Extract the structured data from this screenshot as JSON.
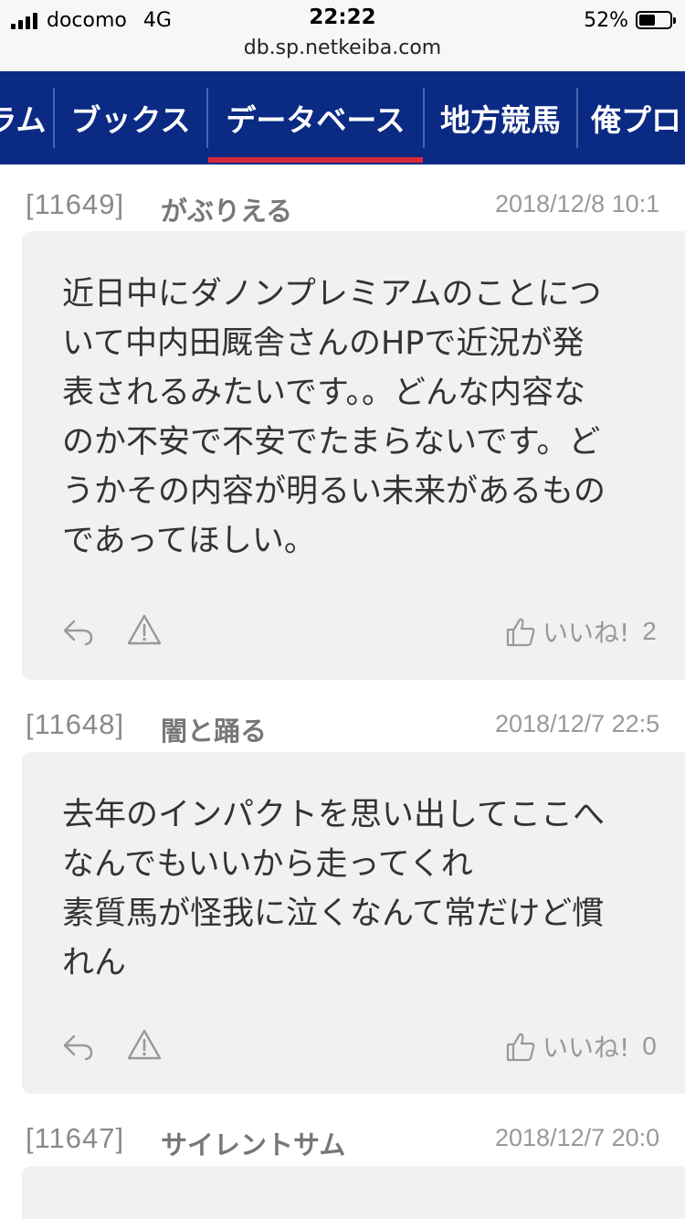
{
  "status_bar": {
    "carrier": "docomo",
    "network": "4G",
    "time": "22:22",
    "url": "db.sp.netkeiba.com",
    "battery_text": "52%",
    "battery_level": 0.52
  },
  "nav": {
    "items": [
      {
        "label": "ラム"
      },
      {
        "label": "ブックス"
      },
      {
        "label": "データベース",
        "active": true
      },
      {
        "label": "地方競馬"
      },
      {
        "label": "俺プロ"
      }
    ],
    "active_color": "#d7293a",
    "background": "#0b2a83"
  },
  "posts": [
    {
      "number": "[11649]",
      "author": "がぶりえる",
      "date": "2018/12/8 10:1",
      "body": "近日中にダノンプレミアムのことにつ\nいて中内田厩舎さんのHPで近況が発\n表されるみたいです。。どんな内容な\nのか不安で不安でたまらないです。ど\nうかその内容が明るい未来があるもの\nであってほしい。",
      "like_label": "いいね!",
      "like_count": "2"
    },
    {
      "number": "[11648]",
      "author": "闇と踊る",
      "date": "2018/12/7 22:5",
      "body": "去年のインパクトを思い出してここへ\nなんでもいいから走ってくれ\n素質馬が怪我に泣くなんて常だけど慣\nれん",
      "like_label": "いいね!",
      "like_count": "0"
    },
    {
      "number": "[11647]",
      "author": "サイレントサム",
      "date": "2018/12/7 20:0"
    }
  ]
}
